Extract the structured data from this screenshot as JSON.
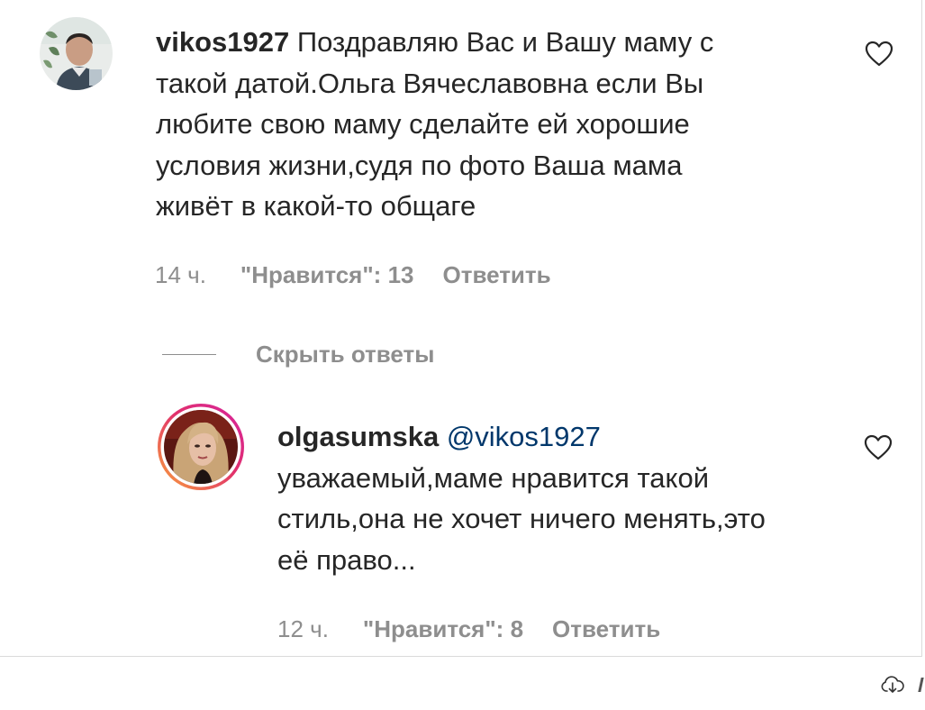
{
  "comment": {
    "username": "vikos1927",
    "text": "Поздравляю Вас и Вашу маму с\nтакой датой.Ольга Вячеславовна если Вы\nлюбите свою маму сделайте ей хорошие\nусловия жизни,судя по фото Ваша мама\nживёт в какой-то общаге",
    "time": "14 ч.",
    "likes": "\"Нравится\": 13",
    "reply_label": "Ответить"
  },
  "hide_replies_label": "Скрыть ответы",
  "reply": {
    "username": "olgasumska",
    "mention": "@vikos1927",
    "text": "уважаемый,маме нравится такой\nстиль,она не хочет ничего менять,это\nеё право...",
    "time": "12 ч.",
    "likes": "\"Нравится\": 8",
    "reply_label": "Ответить"
  },
  "colors": {
    "text": "#262626",
    "secondary": "#8e8e8e",
    "mention": "#00376b",
    "story_ring_start": "#f9a33b",
    "story_ring_end": "#d6249f"
  },
  "icons": [
    "heart-icon",
    "download-icon"
  ]
}
